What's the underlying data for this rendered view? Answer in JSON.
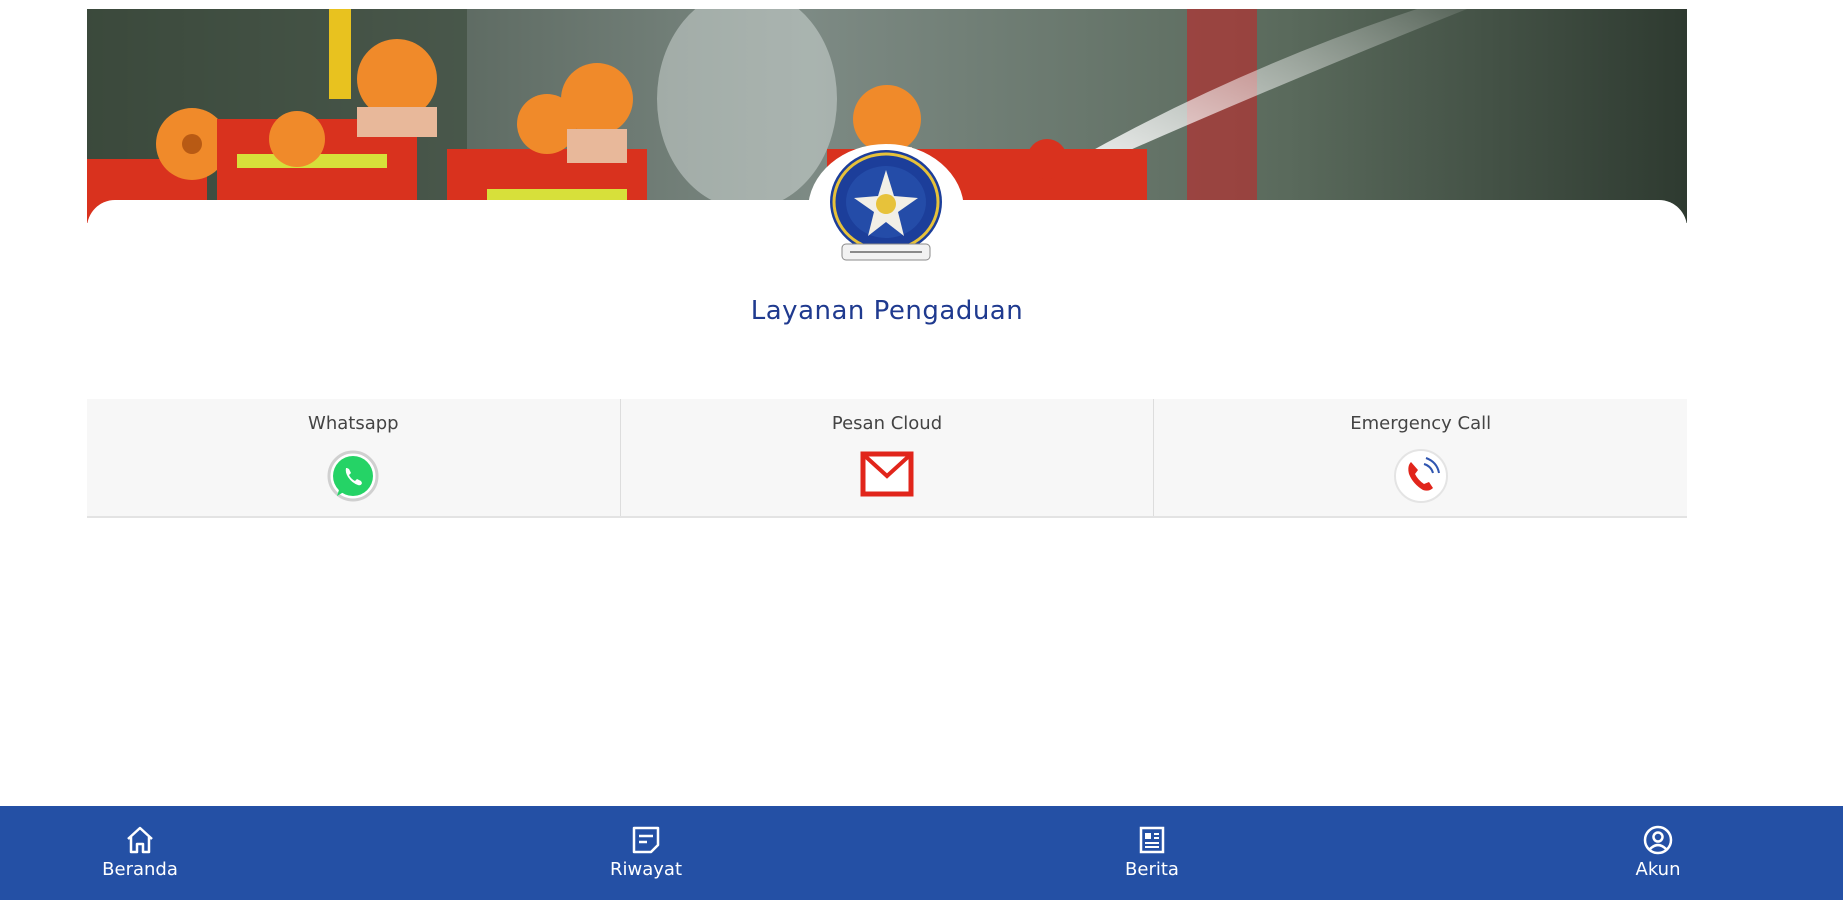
{
  "header": {
    "banner_alt": "fire-fighters-banner",
    "logo_alt": "emblem-logo"
  },
  "main": {
    "title": "Layanan Pengaduan",
    "title_color": "#1f3a8f",
    "services": [
      {
        "label": "Whatsapp",
        "icon": "whatsapp-icon"
      },
      {
        "label": "Pesan Cloud",
        "icon": "mail-icon"
      },
      {
        "label": "Emergency Call",
        "icon": "phone-call-icon"
      }
    ]
  },
  "nav": {
    "background": "#2450a5",
    "items": [
      {
        "label": "Beranda",
        "icon": "home-icon"
      },
      {
        "label": "Riwayat",
        "icon": "history-icon"
      },
      {
        "label": "Berita",
        "icon": "news-icon"
      },
      {
        "label": "Akun",
        "icon": "account-icon"
      }
    ]
  },
  "colors": {
    "whatsapp": "#25d366",
    "mail": "#e1251b",
    "phone": "#e1251b"
  }
}
